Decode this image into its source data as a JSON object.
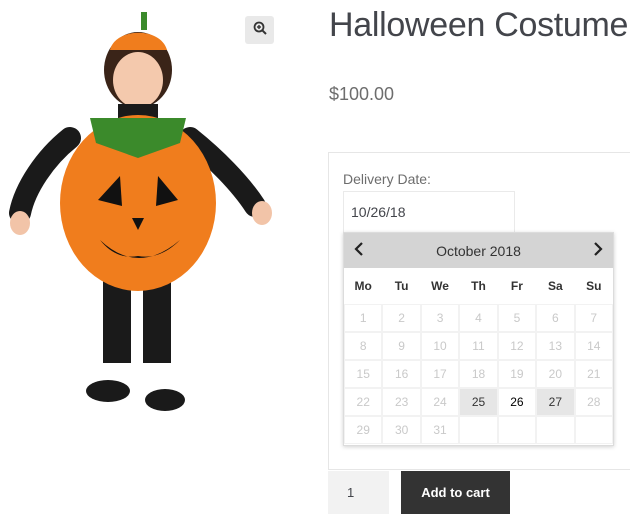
{
  "product": {
    "title": "Halloween Costume",
    "price": "$100.00",
    "image_alt": "Child in pumpkin costume"
  },
  "delivery": {
    "label": "Delivery Date:",
    "value": "10/26/18"
  },
  "calendar": {
    "month_label": "October 2018",
    "weekdays": [
      "Mo",
      "Tu",
      "We",
      "Th",
      "Fr",
      "Sa",
      "Su"
    ],
    "rows": [
      [
        {
          "d": "1",
          "s": "disabled"
        },
        {
          "d": "2",
          "s": "disabled"
        },
        {
          "d": "3",
          "s": "disabled"
        },
        {
          "d": "4",
          "s": "disabled"
        },
        {
          "d": "5",
          "s": "disabled"
        },
        {
          "d": "6",
          "s": "disabled"
        },
        {
          "d": "7",
          "s": "disabled"
        }
      ],
      [
        {
          "d": "8",
          "s": "disabled"
        },
        {
          "d": "9",
          "s": "disabled"
        },
        {
          "d": "10",
          "s": "disabled"
        },
        {
          "d": "11",
          "s": "disabled"
        },
        {
          "d": "12",
          "s": "disabled"
        },
        {
          "d": "13",
          "s": "disabled"
        },
        {
          "d": "14",
          "s": "disabled"
        }
      ],
      [
        {
          "d": "15",
          "s": "disabled"
        },
        {
          "d": "16",
          "s": "disabled"
        },
        {
          "d": "17",
          "s": "disabled"
        },
        {
          "d": "18",
          "s": "disabled"
        },
        {
          "d": "19",
          "s": "disabled"
        },
        {
          "d": "20",
          "s": "disabled"
        },
        {
          "d": "21",
          "s": "disabled"
        }
      ],
      [
        {
          "d": "22",
          "s": "disabled"
        },
        {
          "d": "23",
          "s": "disabled"
        },
        {
          "d": "24",
          "s": "disabled"
        },
        {
          "d": "25",
          "s": "available"
        },
        {
          "d": "26",
          "s": "selected"
        },
        {
          "d": "27",
          "s": "available"
        },
        {
          "d": "28",
          "s": "disabled"
        }
      ],
      [
        {
          "d": "29",
          "s": "disabled"
        },
        {
          "d": "30",
          "s": "disabled"
        },
        {
          "d": "31",
          "s": "disabled"
        },
        {
          "d": "",
          "s": "empty"
        },
        {
          "d": "",
          "s": "empty"
        },
        {
          "d": "",
          "s": "empty"
        },
        {
          "d": "",
          "s": "empty"
        }
      ]
    ]
  },
  "cart": {
    "quantity": "1",
    "add_label": "Add to cart"
  },
  "icons": {
    "zoom": "zoom-in-icon",
    "prev": "chevron-left-icon",
    "next": "chevron-right-icon"
  },
  "colors": {
    "button_bg": "#333333",
    "calendar_header": "#d4d4d4",
    "available_day": "#e6e6e6"
  }
}
